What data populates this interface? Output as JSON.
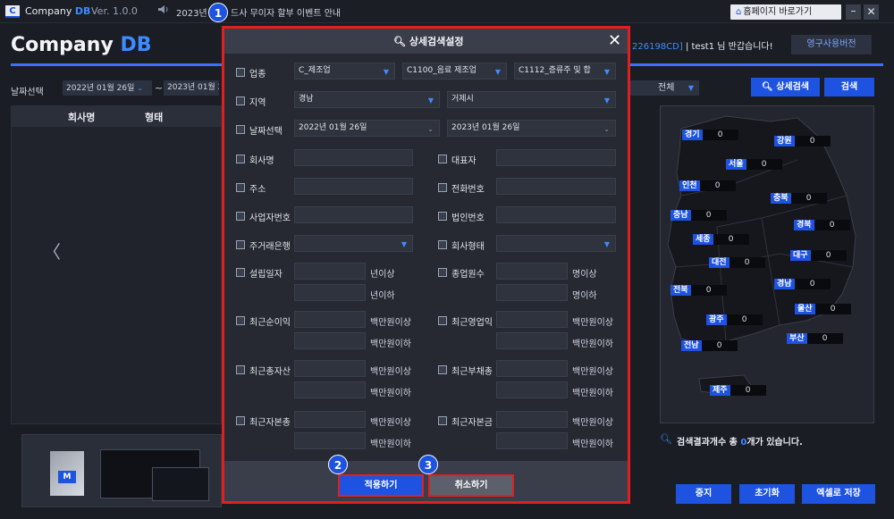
{
  "titlebar": {
    "logo_letter": "C",
    "app_name": "Company",
    "app_name_db": "DB",
    "version": "Ver. 1.0.0",
    "notice_icon": "speaker-icon",
    "notice_part1": "2023년",
    "notice_part2": "드사 무이자 할부 이벤트 안내",
    "homepage_icon": "home-icon",
    "homepage_label": "홈페이지 바로가기",
    "minimize": "–",
    "close": "✕"
  },
  "header": {
    "logo": "Company",
    "logo_db": "DB",
    "user_account": "226198CD]",
    "user_sep": " | ",
    "user_name": "test1",
    "user_greeting": " 님 반갑습니다!",
    "permanent_btn": "영구사용버전"
  },
  "filter": {
    "date_label": "날짜선택",
    "date_from": "2022년 01월 26일",
    "tilde": "~",
    "date_to": "2023년 01월 2",
    "scope": "전체",
    "adv_search": "상세검색",
    "search": "검색"
  },
  "table": {
    "col_company": "회사명",
    "col_type": "형태",
    "prev": "〈"
  },
  "banner": {
    "device_logo": "M"
  },
  "map": {
    "regions": [
      {
        "name": "경기",
        "count": "0"
      },
      {
        "name": "강원",
        "count": "0"
      },
      {
        "name": "서울",
        "count": "0"
      },
      {
        "name": "인천",
        "count": "0"
      },
      {
        "name": "충북",
        "count": "0"
      },
      {
        "name": "충남",
        "count": "0"
      },
      {
        "name": "경북",
        "count": "0"
      },
      {
        "name": "세종",
        "count": "0"
      },
      {
        "name": "대구",
        "count": "0"
      },
      {
        "name": "대전",
        "count": "0"
      },
      {
        "name": "경남",
        "count": "0"
      },
      {
        "name": "전북",
        "count": "0"
      },
      {
        "name": "울산",
        "count": "0"
      },
      {
        "name": "광주",
        "count": "0"
      },
      {
        "name": "부산",
        "count": "0"
      },
      {
        "name": "전남",
        "count": "0"
      },
      {
        "name": "제주",
        "count": "0"
      }
    ]
  },
  "result": {
    "icon": "search-icon",
    "prefix": "검색결과개수 총 ",
    "count": "0",
    "suffix": "개가 있습니다."
  },
  "actions": {
    "stop": "중지",
    "reset": "초기화",
    "excel": "엑셀로 저장"
  },
  "modal": {
    "title": "상세검색설정",
    "close": "✕",
    "industry_label": "업종",
    "industry_1": "C_제조업",
    "industry_2": "C1100_음료 제조업",
    "industry_3": "C1112_증류주 및 합",
    "region_label": "지역",
    "region_1": "경남",
    "region_2": "거제시",
    "date_label": "날짜선택",
    "date_from": "2022년 01월 26일",
    "date_to": "2023년 01월 26일",
    "company_name": "회사명",
    "ceo": "대표자",
    "address": "주소",
    "phone": "전화번호",
    "biz_no": "사업자번호",
    "corp_no": "법인번호",
    "bank": "주거래은행",
    "company_type": "회사형태",
    "founded": "설립일자",
    "employees": "종업원수",
    "years_min": "년이상",
    "years_max": "년이하",
    "people_min": "명이상",
    "people_max": "명이하",
    "net_income": "최근순이익",
    "op_income": "최근영업익",
    "total_assets": "최근총자산",
    "total_debt": "최근부채총",
    "total_equity": "최근자본총",
    "capital": "최근자본금",
    "mil_min": "백만원이상",
    "mil_max": "백만원이하",
    "apply": "적용하기",
    "cancel": "취소하기"
  },
  "badges": [
    "1",
    "2",
    "3"
  ]
}
